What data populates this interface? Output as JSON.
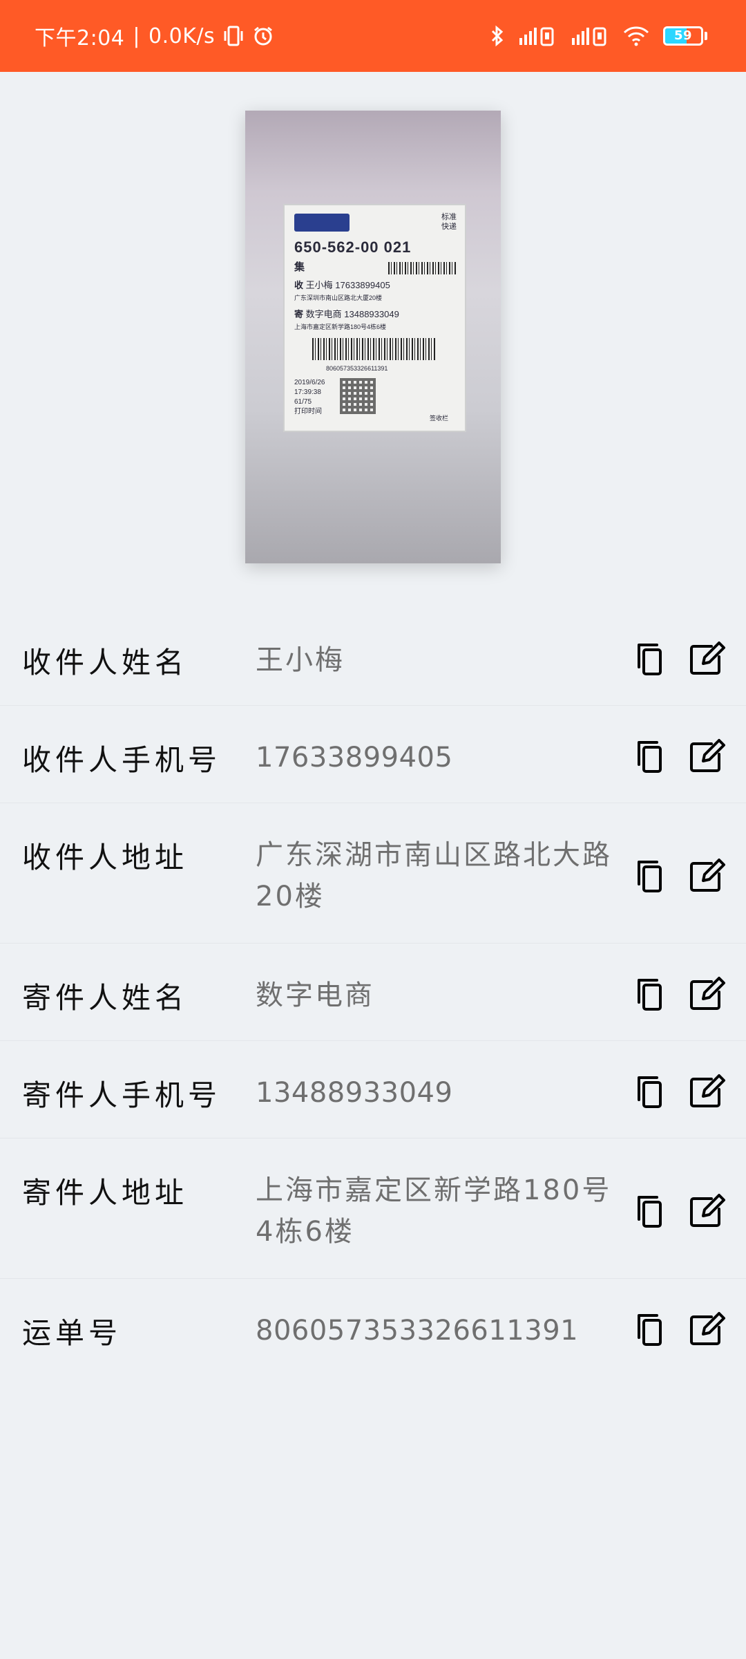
{
  "status_bar": {
    "time": "下午2:04",
    "network_speed": "0.0K/s",
    "battery_level": "59",
    "battery_fraction": 0.59,
    "icons": [
      "vibrate-icon",
      "alarm-icon",
      "bluetooth-icon",
      "signal-icon",
      "signal-icon",
      "wifi-icon",
      "battery-icon"
    ],
    "bg_color": "#ff5a26"
  },
  "photo": {
    "label": {
      "service": [
        "标准",
        "快递"
      ],
      "sort_code": "650-562-00  021",
      "collect": "集",
      "receiver_mark": "收",
      "receiver_name": "王小梅",
      "receiver_phone": "17633899405",
      "receiver_address": "广东深圳市南山区路北大厦20楼",
      "sender_mark": "寄",
      "sender_name": "数字电商",
      "sender_phone": "13488933049",
      "sender_address": "上海市嘉定区新学路180号4栋6楼",
      "tracking": "806057353326611391",
      "date": "2019/6/26",
      "clock": "17:39:38",
      "page": "61/75",
      "print_label": "打印时间",
      "sign_label": "签收栏"
    }
  },
  "fields": [
    {
      "label": "收件人姓名",
      "value": "王小梅"
    },
    {
      "label": "收件人手机号",
      "value": "17633899405"
    },
    {
      "label": "收件人地址",
      "value": "广东深湖市南山区路北大路20楼"
    },
    {
      "label": "寄件人姓名",
      "value": "数字电商"
    },
    {
      "label": "寄件人手机号",
      "value": "13488933049"
    },
    {
      "label": "寄件人地址",
      "value": "上海市嘉定区新学路180号4栋6楼"
    },
    {
      "label": "运单号",
      "value": "806057353326611391"
    }
  ],
  "actions": {
    "copy_icon": "copy-icon",
    "edit_icon": "edit-icon"
  }
}
